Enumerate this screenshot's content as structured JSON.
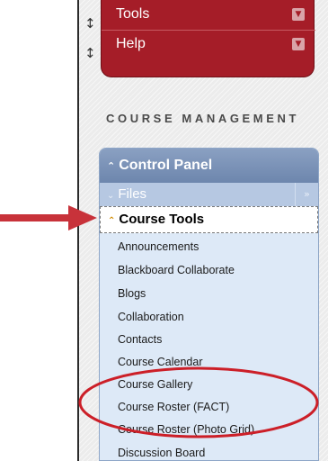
{
  "top_menu": {
    "items": [
      {
        "label": "Tools",
        "icon": "chevron-down-icon"
      },
      {
        "label": "Help",
        "icon": "chevron-down-icon"
      }
    ],
    "handle_icon": "drag-handle-icon"
  },
  "course_management": {
    "heading": "COURSE MANAGEMENT",
    "control_panel": {
      "label": "Control Panel",
      "files_label": "Files",
      "course_tools_label": "Course Tools",
      "tools": [
        "Announcements",
        "Blackboard Collaborate",
        "Blogs",
        "Collaboration",
        "Contacts",
        "Course Calendar",
        "Course Gallery",
        "Course Roster (FACT)",
        "Course Roster (Photo Grid)",
        "Discussion Board"
      ]
    }
  },
  "colors": {
    "menu_red": "#a51d28",
    "panel_blue": "#dde9f7",
    "header_blue": "#7891b7",
    "annotation_red": "#c8323a"
  }
}
